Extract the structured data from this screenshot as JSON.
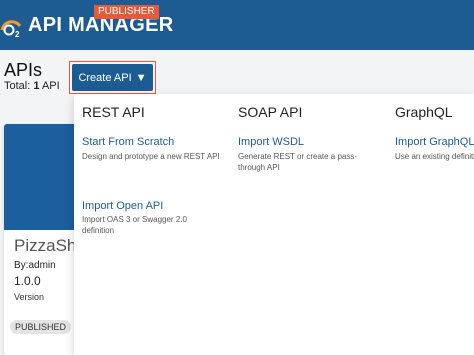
{
  "header": {
    "brand": "API MANAGER",
    "badge": "PUBLISHER"
  },
  "page": {
    "title": "APIs",
    "total_label": "Total:",
    "total_count": "1",
    "total_suffix": "API"
  },
  "create_button": {
    "label": "Create API",
    "caret": "▼"
  },
  "dropdown": {
    "rest": {
      "title": "REST API",
      "scratch_title": "Start From Scratch",
      "scratch_desc": "Design and prototype a new REST API",
      "openapi_title": "Import Open API",
      "openapi_desc": "Import OAS 3 or Swagger 2.0 definition"
    },
    "soap": {
      "title": "SOAP API",
      "wsdl_title": "Import WSDL",
      "wsdl_desc": "Generate REST or create a pass-through API"
    },
    "graphql": {
      "title": "GraphQL",
      "import_title": "Import GraphQL",
      "import_desc": "Use an existing definiti"
    }
  },
  "card": {
    "name": "PizzaSha",
    "by": "By:admin",
    "version": "1.0.0",
    "version_label": "Version",
    "status": "PUBLISHED"
  },
  "colors": {
    "primary": "#1d5b93",
    "accent": "#e55a3a",
    "background": "#f3f4f6"
  }
}
